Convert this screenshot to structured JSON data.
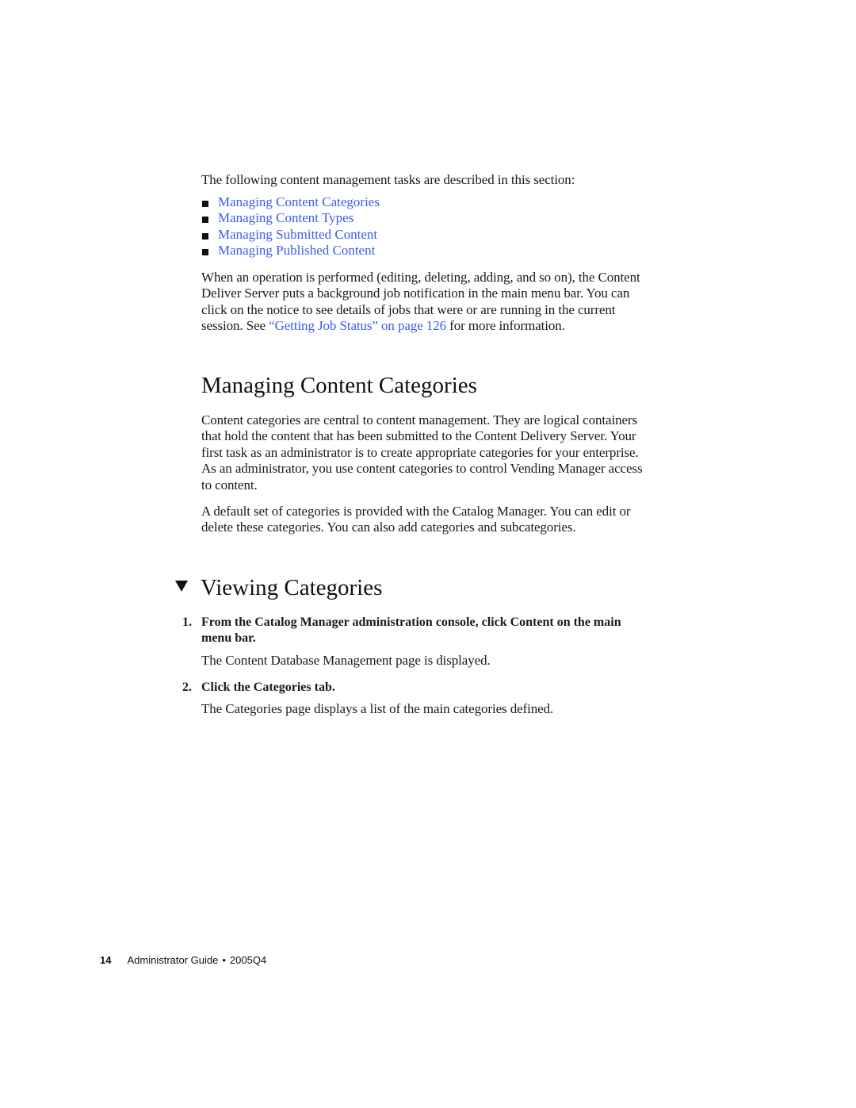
{
  "intro": {
    "text": "The following content management tasks are described in this section:"
  },
  "task_links": [
    {
      "label": "Managing Content Categories"
    },
    {
      "label": "Managing Content Types"
    },
    {
      "label": "Managing Submitted Content"
    },
    {
      "label": "Managing Published Content"
    }
  ],
  "job_paragraph": {
    "lines": [
      "When an operation is performed (editing, deleting, adding, and so on), the Content",
      "Deliver Server puts a background job notification in the main menu bar. You can",
      "click on the notice to see details of jobs that were or are running in the current"
    ],
    "last_line_prefix": "session. See ",
    "link_text": "“Getting Job Status” on page 126",
    "last_line_suffix": " for more information."
  },
  "section_managing": {
    "heading": "Managing Content Categories",
    "paragraph1_lines": [
      "Content categories are central to content management. They are logical containers",
      "that hold the content that has been submitted to the Content Delivery Server. Your",
      "first task as an administrator is to create appropriate categories for your enterprise.",
      "As an administrator, you use content categories to control Vending Manager access",
      "to content."
    ],
    "paragraph2_lines": [
      "A default set of categories is provided with the Catalog Manager. You can edit or",
      "delete these categories. You can also add categories and subcategories."
    ]
  },
  "section_viewing": {
    "heading": "Viewing Categories",
    "steps": [
      {
        "number": "1.",
        "instruction_lines": [
          "From the Catalog Manager administration console, click Content on the main",
          "menu bar."
        ],
        "result": "The Content Database Management page is displayed."
      },
      {
        "number": "2.",
        "instruction_lines": [
          "Click the Categories tab."
        ],
        "result": "The Categories page displays a list of the main categories defined."
      }
    ]
  },
  "footer": {
    "page_number": "14",
    "title": "Administrator Guide",
    "separator": "•",
    "version": "2005Q4"
  },
  "colors": {
    "link": "#3b5bf0",
    "text": "#1a1a1a"
  }
}
